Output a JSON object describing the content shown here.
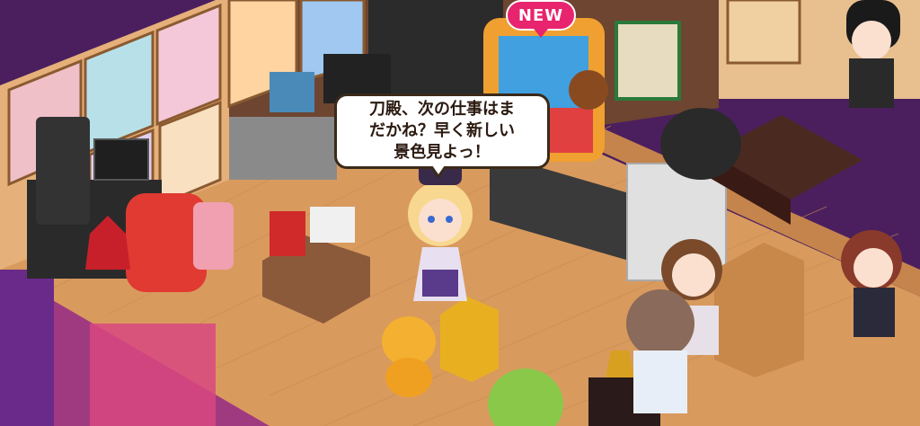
{
  "speech": {
    "text": "刀殿、次の仕事はま\nだかね？早く新しい\n景色見よっ！"
  },
  "badges": {
    "new_label": "NEW"
  },
  "colors": {
    "floor": "#d99a5e",
    "wall": "#5a2a6a",
    "badge": "#e8246e"
  }
}
